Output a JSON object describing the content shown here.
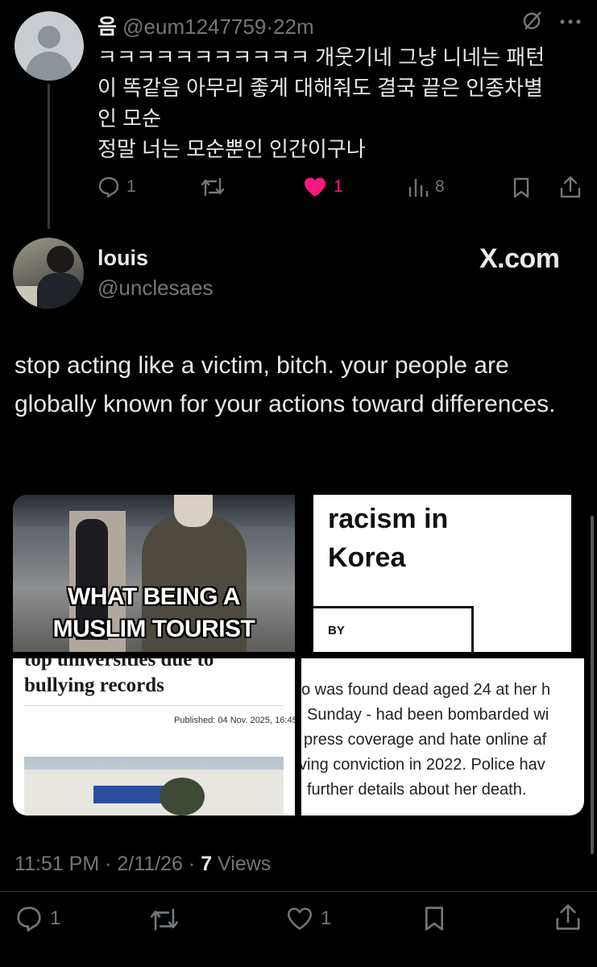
{
  "reply": {
    "name": "음",
    "handle": "@eum1247759",
    "separator": "·",
    "time": "22m",
    "lines": [
      "ㅋㅋㅋㅋㅋㅋㅋㅋㅋㅋㅋ 개웃기네 그냥 니네는 패턴",
      "이 똑같음 아무리 좋게 대해줘도 결국 끝은 인종차별",
      "인 모순",
      "정말 너는 모순뿐인 인간이구나"
    ],
    "actions": {
      "replies": "1",
      "likes": "1",
      "views": "8"
    }
  },
  "tweet": {
    "name": "louis",
    "handle": "@unclesaes",
    "source": "X.com",
    "body": "stop acting like a victim, bitch. your people are globally known for your actions toward differences.",
    "media": {
      "tile1_caption_1": "WHAT BEING A",
      "tile1_caption_2": "MUSLIM TOURIST",
      "tile2_title_1": "racism in",
      "tile2_title_2": "Korea",
      "tile2_by": "BY",
      "tile3_headline_1": "top universities due to",
      "tile3_headline_2": "bullying records",
      "tile3_published": "Published: 04 Nov. 2025, 16:45",
      "tile4_lines": [
        "o was found dead aged 24 at her h",
        "Sunday - had been bombarded wi",
        "press coverage and hate online af",
        "ving conviction in 2022. Police hav",
        "further details about her death."
      ]
    },
    "meta": {
      "time": "11:51 PM",
      "separator": "·",
      "date": "2/11/26",
      "dot": "·",
      "views_count": "7",
      "views_label": "Views"
    },
    "actions": {
      "replies": "1",
      "likes": "1"
    }
  },
  "colors": {
    "background": "#000000",
    "text": "#e7e9ea",
    "muted": "#71767b",
    "like_pink": "#f91880"
  }
}
